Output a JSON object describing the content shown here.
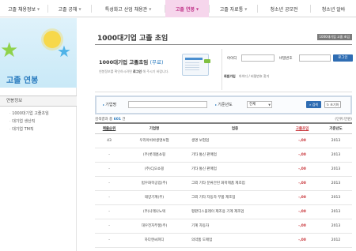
{
  "nav": {
    "items": [
      {
        "label": "고졸 채용정보",
        "active": false
      },
      {
        "label": "고졸 공채",
        "active": false
      },
      {
        "label": "특성화고 산업 채용관",
        "active": false
      },
      {
        "label": "고졸 연봉",
        "active": true
      },
      {
        "label": "고졸 자료통",
        "active": false
      },
      {
        "label": "청소년 공모전",
        "active": false
      },
      {
        "label": "청소년 알바",
        "active": false
      }
    ],
    "chevron_icon": "chevron-down-icon"
  },
  "sidebar": {
    "banner_title": "고졸 연봉",
    "section_title": "연봉정보",
    "items": [
      "1000대기업 고졸초임",
      "대기업 생산직",
      "대기업 TM직"
    ]
  },
  "main": {
    "page_title": "1000대기업 고졸 초임",
    "breadcrumb": "1000대기업 고졸 초임",
    "promo": {
      "title": "1000대기업 고졸초임",
      "free": "(무료)",
      "desc_pre": "연봉정보를 확인하시려면",
      "desc_bold": "로그인",
      "desc_post": "해 주시기 바랍니다."
    },
    "login": {
      "id_label": "아이디",
      "pw_label": "비밀번호",
      "button": "로그인",
      "join_label": "회원가입",
      "find_link": "아이디 / 비밀번호 찾기"
    },
    "search": {
      "company_label": "기업명",
      "year_label": "기준년도",
      "year_value": "전체",
      "search_button": "검색",
      "reset_button": "초기화"
    },
    "result_prefix": "검색결과 총",
    "result_count": "601",
    "result_suffix": "건",
    "unit": "(단위:만원)",
    "table": {
      "headers": [
        "매출순위",
        "기업명",
        "업종",
        "고졸초임",
        "기준년도"
      ],
      "rows": [
        {
          "rank": "43",
          "company": "우리아비바생명보험",
          "industry": "생명 보험업",
          "pay": "-,00",
          "year": "2013"
        },
        {
          "rank": "-",
          "company": "(주)롯데홈쇼핑",
          "industry": "기타 통신 판매업",
          "pay": "-,00",
          "year": "2013"
        },
        {
          "rank": "-",
          "company": "(주)CJ오쇼핑",
          "industry": "기타 통신 판매업",
          "pay": "-,00",
          "year": "2013"
        },
        {
          "rank": "-",
          "company": "범우화학공업(주)",
          "industry": "그외 기타 분류안된 화학제품 제조업",
          "pay": "-,00",
          "year": "2013"
        },
        {
          "rank": "-",
          "company": "태양기계(주)",
          "industry": "그외 기타 자동차 부품 제조업",
          "pay": "-,00",
          "year": "2013"
        },
        {
          "rank": "-",
          "company": "(주)나래나노텍",
          "industry": "평판디스플레이 제조용 기계 제조업",
          "pay": "-,00",
          "year": "2013"
        },
        {
          "rank": "-",
          "company": "대우전자부품(주)",
          "industry": "기계 자동차",
          "pay": "-,00",
          "year": "2013"
        },
        {
          "rank": "-",
          "company": "하다엔씨피디",
          "industry": "의약품 도매업",
          "pay": "-,00",
          "year": "2012"
        }
      ]
    }
  }
}
